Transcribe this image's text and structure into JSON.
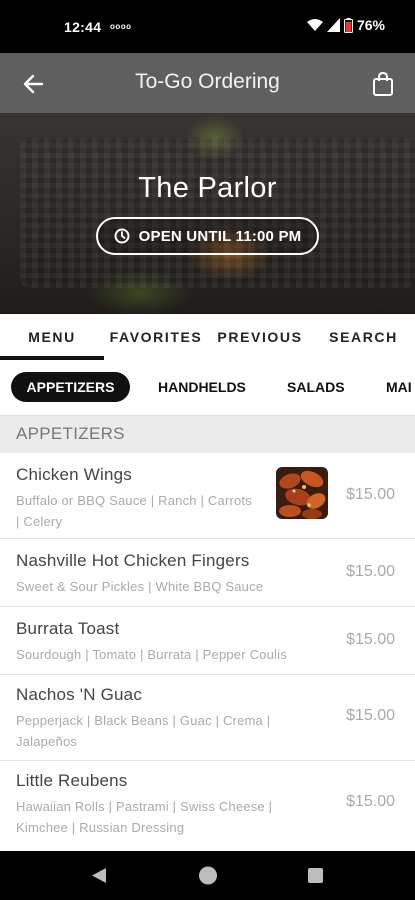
{
  "status_bar": {
    "time": "12:44",
    "extra": "oooo",
    "battery": "76%"
  },
  "header": {
    "title": "To-Go Ordering"
  },
  "hero": {
    "restaurant_name": "The Parlor",
    "hours_label": "OPEN UNTIL 11:00 PM"
  },
  "tabs": [
    {
      "label": "MENU",
      "active": true
    },
    {
      "label": "FAVORITES",
      "active": false
    },
    {
      "label": "PREVIOUS",
      "active": false
    },
    {
      "label": "SEARCH",
      "active": false
    }
  ],
  "categories": [
    {
      "label": "APPETIZERS",
      "active": true
    },
    {
      "label": "HANDHELDS",
      "active": false
    },
    {
      "label": "SALADS",
      "active": false
    },
    {
      "label": "MAI",
      "active": false
    }
  ],
  "section": {
    "title": "APPETIZERS"
  },
  "items": [
    {
      "name": "Chicken Wings",
      "desc_line1": "Buffalo or BBQ Sauce | Ranch | Carrots",
      "desc_line2": "| Celery",
      "price": "$15.00",
      "has_image": true
    },
    {
      "name": "Nashville Hot Chicken Fingers",
      "desc_line1": "Sweet & Sour Pickles | White BBQ Sauce",
      "desc_line2": "",
      "price": "$15.00"
    },
    {
      "name": "Burrata Toast",
      "desc_line1": "Sourdough | Tomato | Burrata | Pepper Coulis",
      "desc_line2": "",
      "price": "$15.00"
    },
    {
      "name": "Nachos 'N Guac",
      "desc_line1": "Pepperjack | Black Beans | Guac | Crema |",
      "desc_line2": "Jalapeños",
      "price": "$15.00"
    },
    {
      "name": "Little Reubens",
      "desc_line1": "Hawaiian Rolls | Pastrami | Swiss Cheese |",
      "desc_line2": "Kimchee | Russian Dressing",
      "price": "$15.00"
    }
  ],
  "colors": {
    "header_bg": "#5f5f60",
    "active_chip": "#111111",
    "price": "#aaaaaa"
  },
  "icons": [
    "back-arrow-icon",
    "shopping-bag-icon",
    "clock-icon",
    "wifi-icon",
    "signal-icon",
    "battery-icon",
    "nav-back-icon",
    "nav-home-icon",
    "nav-recents-icon"
  ]
}
